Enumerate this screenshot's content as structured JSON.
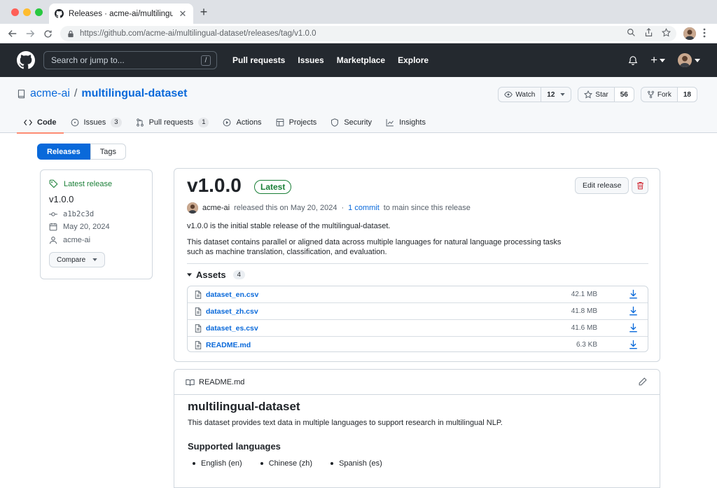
{
  "browser": {
    "tab_title": "Releases · acme-ai/multilingual-dataset",
    "url": "https://github.com/acme-ai/multilingual-dataset/releases/tag/v1.0.0"
  },
  "header": {
    "search_placeholder": "Search or jump to...",
    "search_shortcut": "/",
    "nav": [
      "Pull requests",
      "Issues",
      "Marketplace",
      "Explore"
    ],
    "plus_label": "+"
  },
  "repo": {
    "owner": "acme-ai",
    "separator": "/",
    "name": "multilingual-dataset",
    "watch_label": "Watch",
    "watch_count": "12",
    "star_label": "Star",
    "star_count": "56",
    "fork_label": "Fork",
    "fork_count": "18",
    "tabs": [
      {
        "label": "Code",
        "count": ""
      },
      {
        "label": "Issues",
        "count": "3"
      },
      {
        "label": "Pull requests",
        "count": "1"
      },
      {
        "label": "Actions",
        "count": ""
      },
      {
        "label": "Projects",
        "count": ""
      },
      {
        "label": "Security",
        "count": ""
      },
      {
        "label": "Insights",
        "count": ""
      }
    ]
  },
  "segmented": {
    "releases": "Releases",
    "tags": "Tags"
  },
  "sidebar": {
    "latest_label": "Latest release",
    "version": "v1.0.0",
    "commit": "a1b2c3d",
    "date": "May 20, 2024",
    "author": "acme-ai",
    "compare_label": "Compare"
  },
  "release": {
    "version": "v1.0.0",
    "badge": "Latest",
    "edit_label": "Edit release",
    "author": "acme-ai",
    "released_text": "released this on May 20, 2024",
    "middot": "·",
    "commit_link": "1 commit",
    "since_text": "to main since this release",
    "summary": "v1.0.0 is the initial stable release of the multilingual-dataset.",
    "description": "This dataset contains parallel or aligned data across multiple languages for natural language processing tasks such as machine translation, classification, and evaluation.",
    "assets_label": "Assets",
    "assets_count": "4",
    "assets": [
      {
        "name": "dataset_en.csv",
        "size": "42.1 MB"
      },
      {
        "name": "dataset_zh.csv",
        "size": "41.8 MB"
      },
      {
        "name": "dataset_es.csv",
        "size": "41.6 MB"
      },
      {
        "name": "README.md",
        "size": "6.3 KB"
      }
    ]
  },
  "readme": {
    "file_label": "README.md",
    "title": "multilingual-dataset",
    "paragraph": "This dataset provides text data in multiple languages to support research in multilingual NLP.",
    "section_title": "Supported languages",
    "languages": [
      "English (en)",
      "Chinese (zh)",
      "Spanish (es)"
    ]
  },
  "colors": {
    "accent": "#0969da",
    "header_bg": "#24292f",
    "success": "#1a7f37",
    "danger": "#cf222e",
    "tab_underline": "#fd8c73"
  }
}
